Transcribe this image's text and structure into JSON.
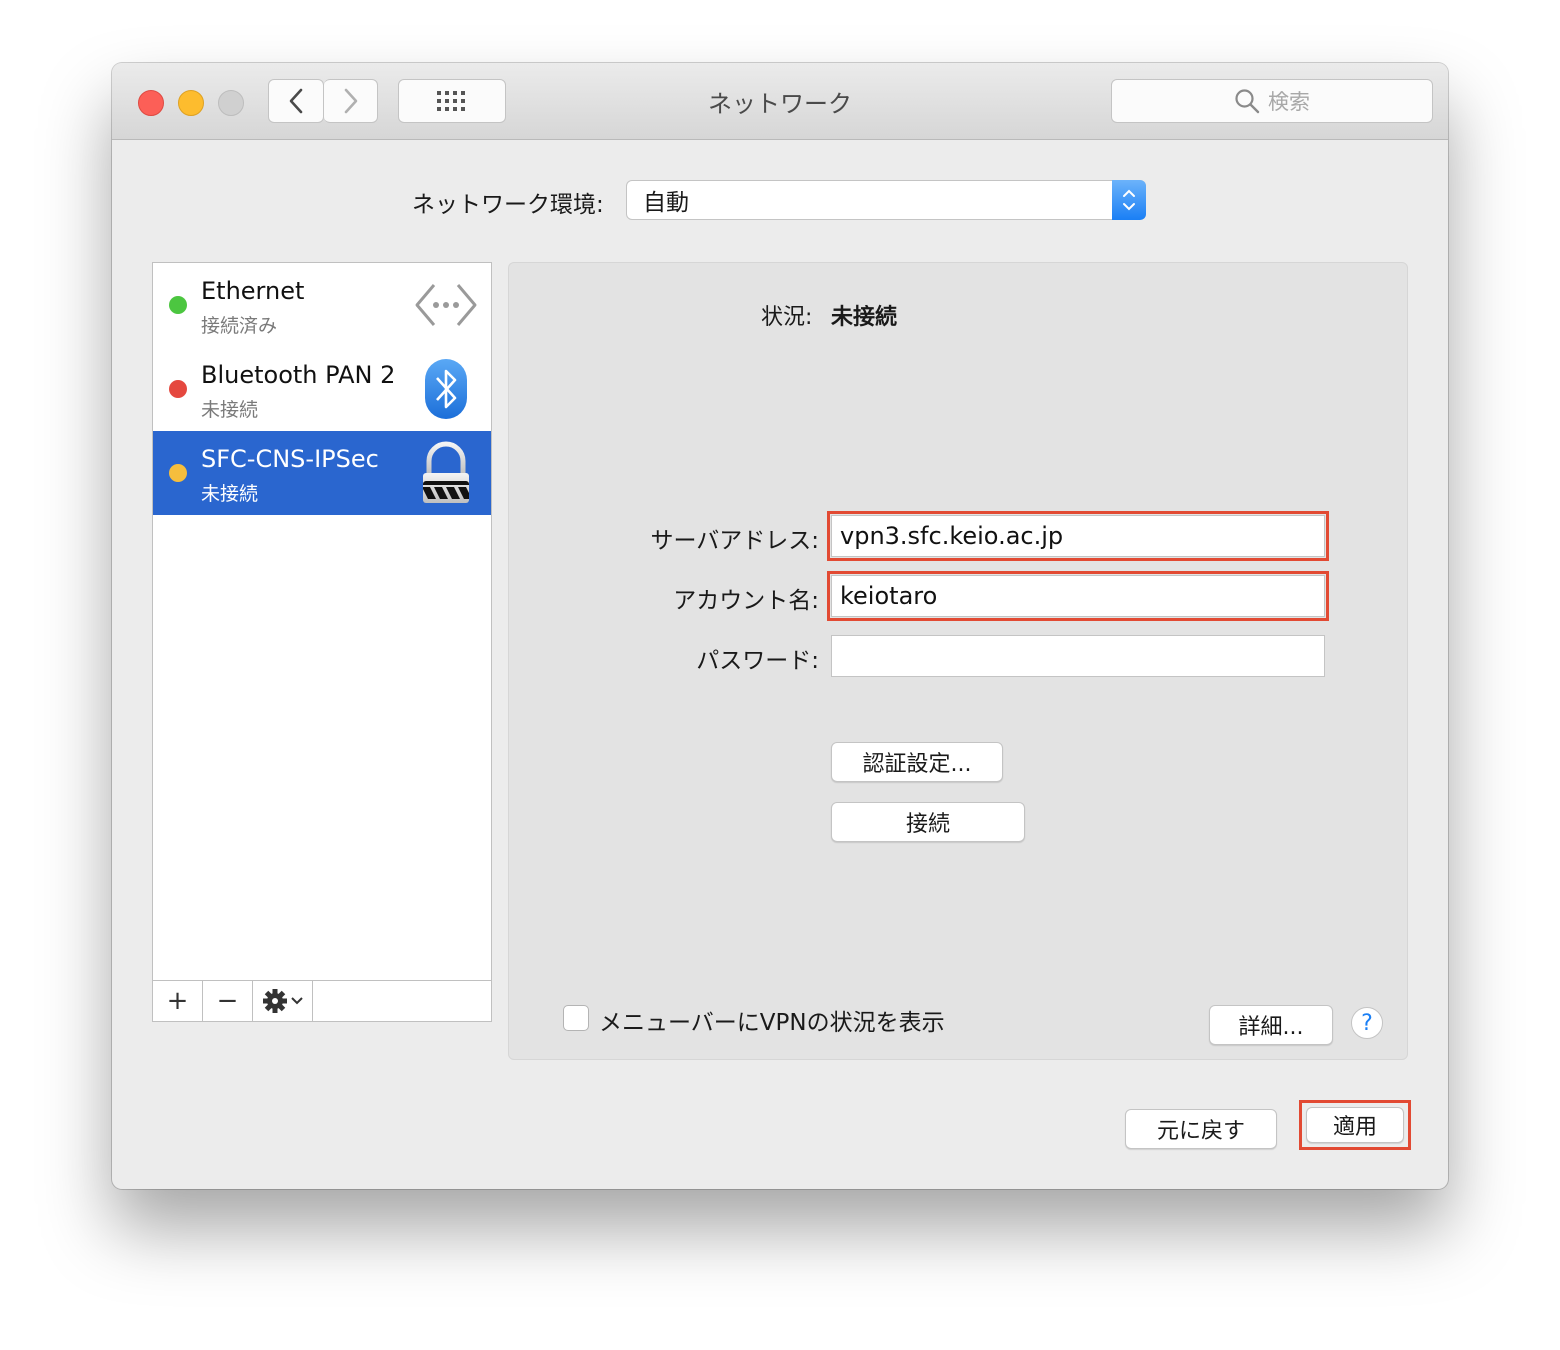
{
  "window": {
    "title": "ネットワーク",
    "search_placeholder": "検索"
  },
  "location": {
    "label": "ネットワーク環境:",
    "value": "自動"
  },
  "services": [
    {
      "name": "Ethernet",
      "status": "接続済み",
      "dot_color": "#4cc640",
      "icon": "ethernet-arrows-icon"
    },
    {
      "name": "Bluetooth PAN 2",
      "status": "未接続",
      "dot_color": "#e5483f",
      "icon": "bluetooth-icon"
    },
    {
      "name": "SFC-CNS-IPSec",
      "status": "未接続",
      "dot_color": "#f6be3d",
      "icon": "vpn-lock-icon"
    }
  ],
  "sidebar_actions": {
    "add": "+",
    "remove": "−"
  },
  "detail": {
    "status_label": "状況:",
    "status_value": "未接続",
    "server_label": "サーバアドレス:",
    "server_value": "vpn3.sfc.keio.ac.jp",
    "account_label": "アカウント名:",
    "account_value": "keiotaro",
    "password_label": "パスワード:",
    "password_value": "",
    "auth_button": "認証設定...",
    "connect_button": "接続",
    "show_vpn_label": "メニューバーにVPNの状況を表示",
    "advanced_button": "詳細...",
    "help": "?"
  },
  "footer": {
    "revert_button": "元に戻す",
    "apply_button": "適用"
  },
  "colors": {
    "selection": "#2a66cf",
    "highlight": "#e24a33",
    "accent": "#1a7ff5"
  }
}
